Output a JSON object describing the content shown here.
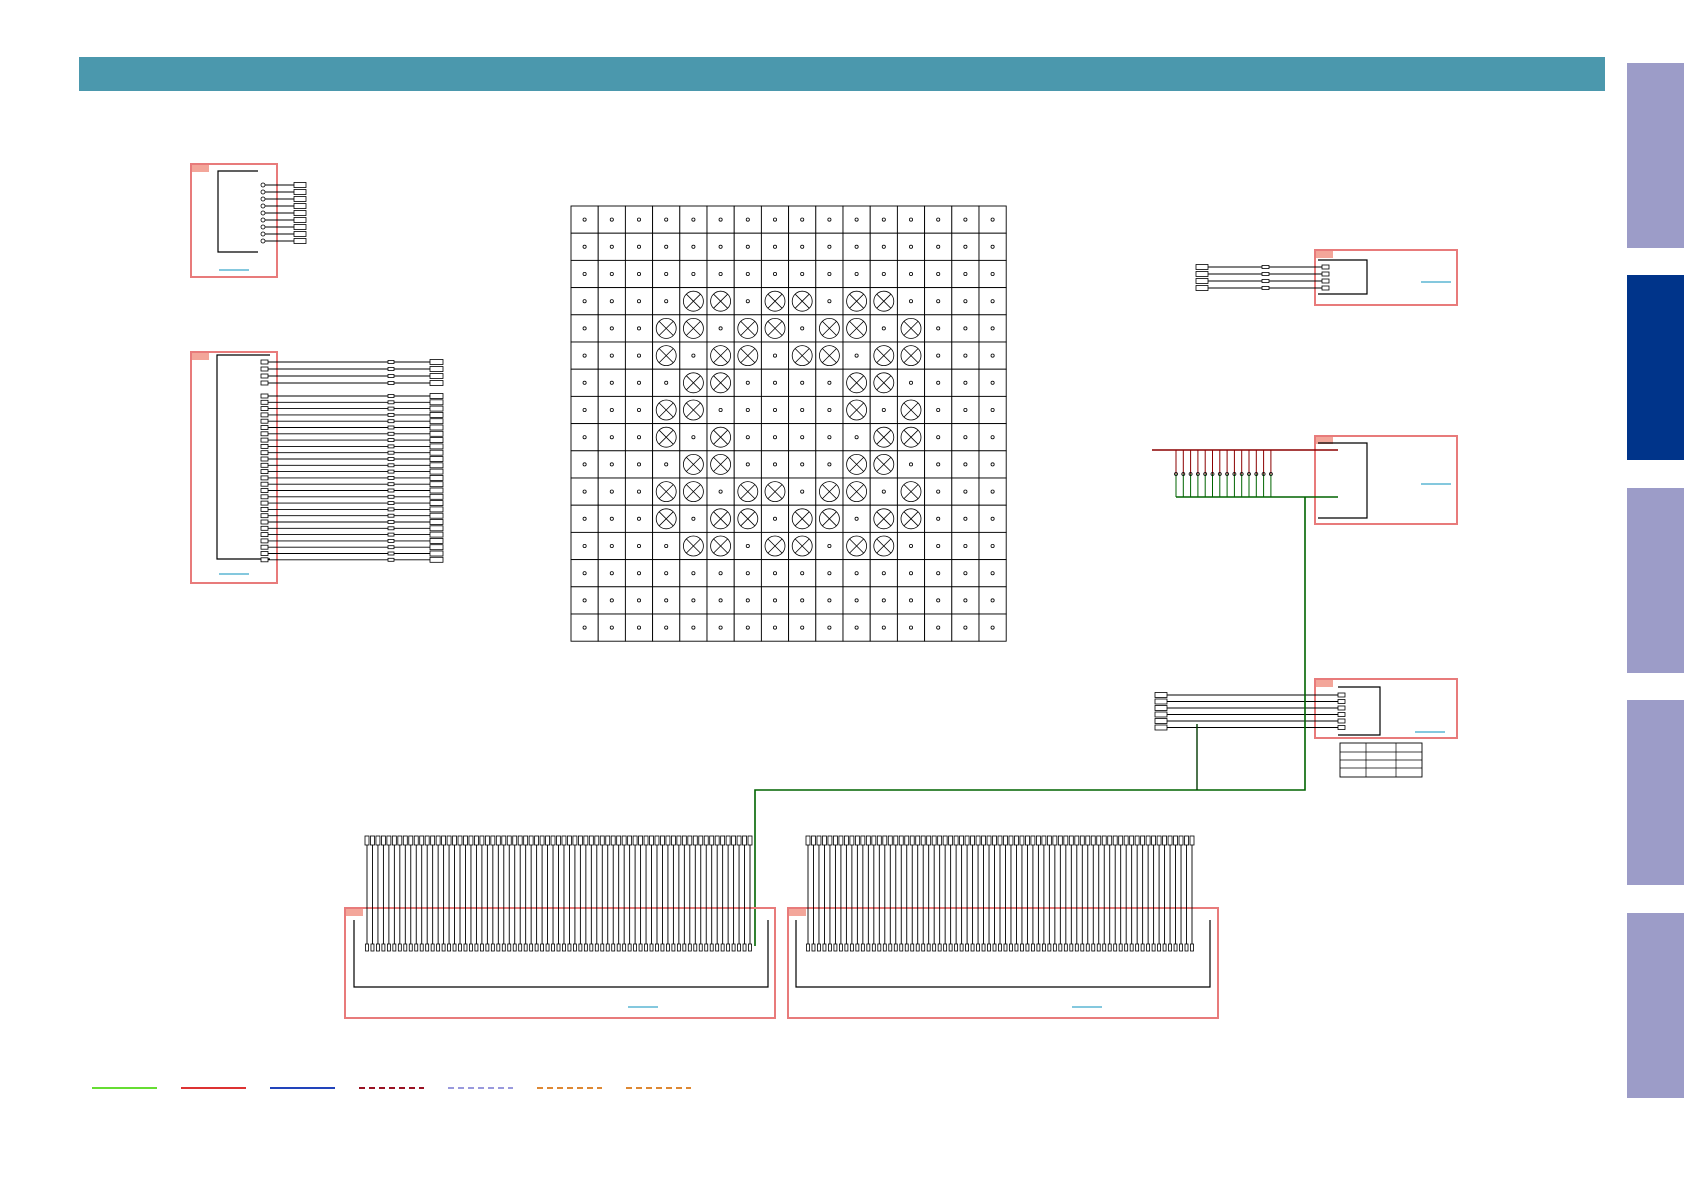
{
  "header": {
    "color": "#4b98ad"
  },
  "side_tabs": [
    {
      "state": "inactive",
      "color": "#9c9cc8"
    },
    {
      "state": "active",
      "color": "#00348a"
    },
    {
      "state": "inactive",
      "color": "#9c9cc8"
    },
    {
      "state": "inactive",
      "color": "#9c9cc8"
    },
    {
      "state": "inactive",
      "color": "#9c9cc8"
    }
  ],
  "colors": {
    "block_frame": "#e87b7b",
    "block_tag": "#f3a69a",
    "link": "#3aa6c9",
    "bus_green": "#006400",
    "bus_red": "#8b0000"
  },
  "bga": {
    "rows": 16,
    "cols": 16
  },
  "legend": [
    {
      "style": "solid",
      "color": "#66dd33"
    },
    {
      "style": "solid",
      "color": "#dd3333"
    },
    {
      "style": "solid",
      "color": "#2244bb"
    },
    {
      "style": "dashed",
      "color": "#991122"
    },
    {
      "style": "dashed",
      "color": "#9999dd"
    },
    {
      "style": "dashed",
      "color": "#dd8833"
    },
    {
      "style": "dashed",
      "color": "#dd8833"
    }
  ]
}
